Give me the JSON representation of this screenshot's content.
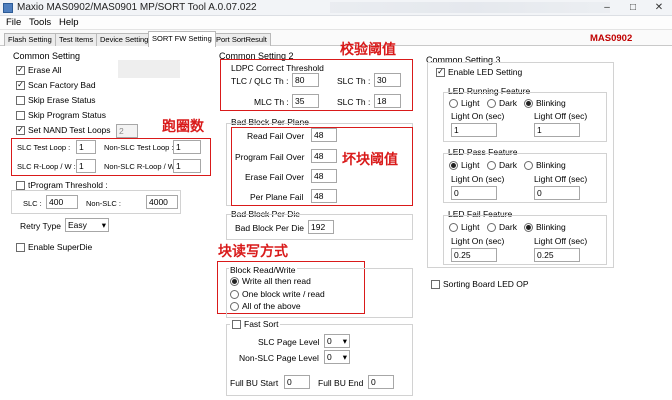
{
  "window": {
    "title": "Maxio MAS0902/MAS0901 MP/SORT Tool A.0.07.022",
    "minimize": "–",
    "maximize": "□",
    "close": "✕"
  },
  "menu": [
    "File",
    "Tools",
    "Help"
  ],
  "tabs": [
    "Flash Setting",
    "Test Items",
    "Device Setting",
    "SORT FW Setting",
    "Port SortResult"
  ],
  "brand": "MAS0902",
  "cs1": {
    "title": "Common Setting",
    "erase_all": "Erase All",
    "scan_factory_bad": "Scan Factory Bad",
    "skip_erase_status": "Skip Erase Status",
    "skip_program_status": "Skip Program Status",
    "set_nand_test_loops": "Set NAND Test Loops",
    "nand_test_loops_value": "2",
    "slc_test_loop_label": "SLC Test Loop :",
    "slc_test_loop_value": "1",
    "non_slc_test_loop_label": "Non-SLC Test Loop :",
    "non_slc_test_loop_value": "1",
    "slc_r_loop_label": "SLC R-Loop / W :",
    "slc_r_loop_value": "1",
    "non_slc_r_loop_label": "Non-SLC R-Loop / W :",
    "non_slc_r_loop_value": "1",
    "tprogram_threshold": "tProgram Threshold :",
    "slc_label": "SLC :",
    "slc_value": "400",
    "non_slc_label": "Non-SLC :",
    "non_slc_value": "4000",
    "retry_type_label": "Retry Type",
    "retry_type_value": "Easy",
    "enable_superdie": "Enable SuperDie"
  },
  "cs2": {
    "title": "Common Setting 2",
    "ldpc_title": "LDPC Correct Threshold",
    "tlc_qlc_label": "TLC / QLC Th :",
    "tlc_qlc_value": "80",
    "slc_th_label": "SLC Th :",
    "slc_th_value": "30",
    "mlc_th_label": "MLC Th :",
    "mlc_th_value": "35",
    "slc_th2_label": "SLC Th :",
    "slc_th2_value": "18",
    "bad_block_plane_title": "Bad Block Per Plane",
    "read_fail_label": "Read Fail Over",
    "read_fail_value": "48",
    "program_fail_label": "Program Fail Over",
    "program_fail_value": "48",
    "erase_fail_label": "Erase Fail Over",
    "erase_fail_value": "48",
    "per_plane_fail_label": "Per Plane Fail",
    "per_plane_fail_value": "48",
    "bad_block_die_title": "Bad Block Per Die",
    "bad_block_die_label": "Bad Block Per Die",
    "bad_block_die_value": "192",
    "block_rw_title": "Block Read/Write",
    "opt_write_all": "Write all then read",
    "opt_one_block": "One block write / read",
    "opt_all_above": "All of the above",
    "fast_sort": "Fast Sort",
    "slc_page_level_label": "SLC Page Level",
    "slc_page_level_value": "0",
    "non_slc_page_level_label": "Non-SLC Page Level",
    "non_slc_page_level_value": "0",
    "full_bu_start_label": "Full BU Start",
    "full_bu_start_value": "0",
    "full_bu_end_label": "Full BU End",
    "full_bu_end_value": "0"
  },
  "cs3": {
    "title": "Common Setting 3",
    "enable_led": "Enable LED Setting",
    "running_title": "LED Running Feature",
    "pass_title": "LED Pass Feature",
    "fail_title": "LED Fail Feature",
    "light": "Light",
    "dark": "Dark",
    "blinking": "Blinking",
    "light_on": "Light On (sec)",
    "light_off": "Light Off (sec)",
    "running_on": "1",
    "running_off": "1",
    "pass_on": "0",
    "pass_off": "0",
    "fail_on": "0.25",
    "fail_off": "0.25",
    "sorting_board": "Sorting Board LED OP"
  },
  "annotations": {
    "verify_threshold": "校验阈值",
    "run_loops": "跑圈数",
    "bad_block_threshold": "坏块阈值",
    "rw_mode": "块读写方式"
  },
  "colors": {
    "annotation_red": "#d91a1a",
    "brand_red": "#c00000"
  }
}
